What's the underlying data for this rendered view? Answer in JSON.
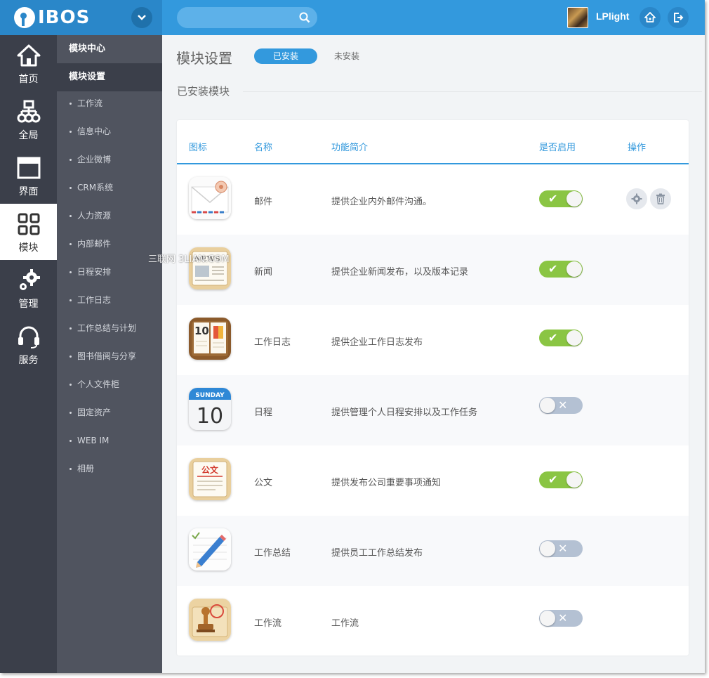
{
  "app": {
    "logo_text": "IBOS",
    "username": "LPlight",
    "search": {
      "value": "",
      "placeholder": ""
    }
  },
  "leftnav": [
    {
      "label": "首页",
      "icon": "home-icon"
    },
    {
      "label": "全局",
      "icon": "org-chart-icon"
    },
    {
      "label": "界面",
      "icon": "window-icon"
    },
    {
      "label": "模块",
      "icon": "grid-icon",
      "active": true
    },
    {
      "label": "管理",
      "icon": "gears-icon"
    },
    {
      "label": "服务",
      "icon": "headset-icon"
    }
  ],
  "subnav": {
    "headers": [
      "模块中心",
      "模块设置"
    ],
    "items": [
      "工作流",
      "信息中心",
      "企业微博",
      "CRM系统",
      "人力资源",
      "内部邮件",
      "日程安排",
      "工作日志",
      "工作总结与计划",
      "图书借阅与分享",
      "个人文件柜",
      "固定资产",
      "WEB IM",
      "相册"
    ]
  },
  "main": {
    "title": "模块设置",
    "tabs": [
      "已安装",
      "未安装"
    ],
    "section_title": "已安装模块",
    "columns": [
      "图标",
      "名称",
      "功能简介",
      "是否启用",
      "操作"
    ],
    "rows": [
      {
        "name": "邮件",
        "desc": "提供企业内外邮件沟通。",
        "enabled": true,
        "icon": "mail-icon"
      },
      {
        "name": "新闻",
        "desc": "提供企业新闻发布，以及版本记录",
        "enabled": true,
        "icon": "news-icon",
        "icon_text": "NEWS"
      },
      {
        "name": "工作日志",
        "desc": "提供企业工作日志发布",
        "enabled": true,
        "icon": "diary-icon",
        "icon_text": "10"
      },
      {
        "name": "日程",
        "desc": "提供管理个人日程安排以及工作任务",
        "enabled": false,
        "icon": "calendar-icon",
        "icon_text": "10",
        "icon_header": "SUNDAY"
      },
      {
        "name": "公文",
        "desc": "提供发布公司重要事项通知",
        "enabled": true,
        "icon": "document-icon",
        "icon_text": "公文"
      },
      {
        "name": "工作总结",
        "desc": "提供员工工作总结发布",
        "enabled": false,
        "icon": "summary-icon"
      },
      {
        "name": "工作流",
        "desc": "工作流",
        "enabled": false,
        "icon": "stamp-icon"
      }
    ],
    "toggle_on_symbol": "✔",
    "toggle_off_symbol": "✕"
  },
  "watermark": "三联网 3LIAN.COM",
  "colors": {
    "brand_blue": "#3399dd",
    "nav_dark": "#3b3f4a",
    "subnav_gray": "#50545f",
    "toggle_on": "#8ac543",
    "toggle_off": "#b4c1d3"
  }
}
